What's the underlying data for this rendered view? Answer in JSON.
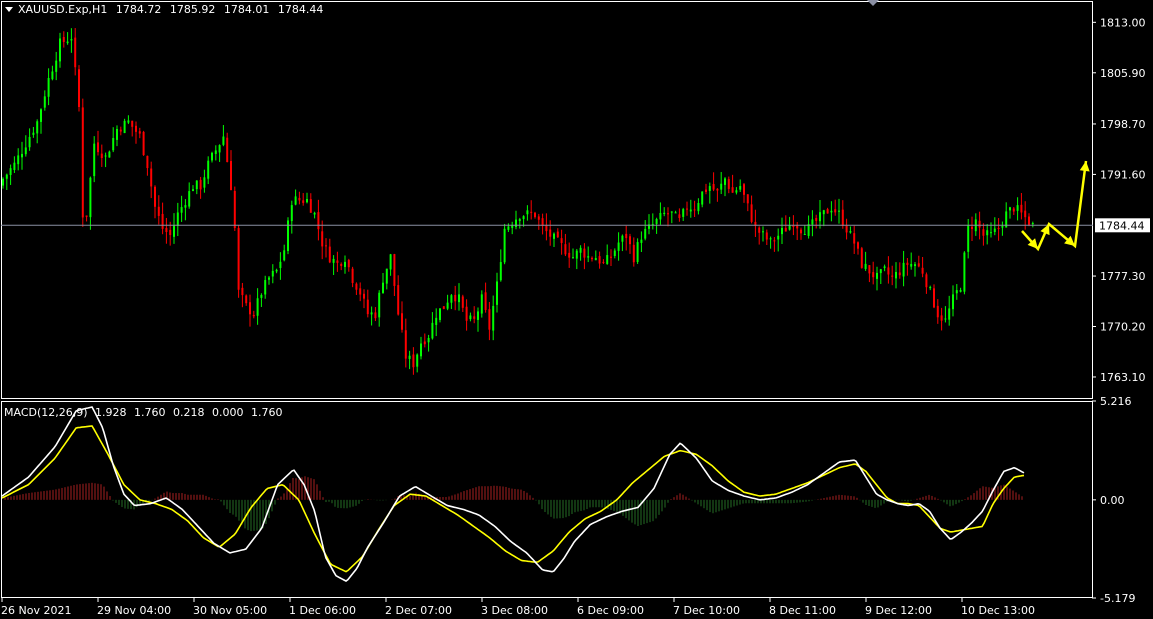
{
  "header": {
    "symbol": "XAUUSD.Exp,H1",
    "open": "1784.72",
    "high": "1785.92",
    "low": "1784.01",
    "close": "1784.44"
  },
  "macd_header": {
    "name": "MACD(12,26,9)",
    "values": [
      "1.928",
      "1.760",
      "0.218",
      "0.000",
      "1.760"
    ]
  },
  "colors": {
    "background": "#000000",
    "bull": "#00ff00",
    "bear": "#ff0000",
    "grid_border": "#ffffff",
    "current_price_line": "#8a8fa3",
    "arrow": "#ffff00",
    "macd_line": "#ffffff",
    "signal_line": "#ffff00",
    "hist_pos": "#8b1a1a",
    "hist_neg": "#1f5a1f"
  },
  "chart_data": [
    {
      "type": "candlestick",
      "ylim": [
        1760.0,
        1816.0
      ],
      "y_ticks": [
        "1813.00",
        "1805.90",
        "1798.70",
        "1791.60",
        "1784.44",
        "1777.30",
        "1770.20",
        "1763.10"
      ],
      "current_price": "1784.44",
      "x_ticks": [
        "26 Nov 2021",
        "29 Nov 04:00",
        "30 Nov 05:00",
        "1 Dec 06:00",
        "2 Dec 07:00",
        "3 Dec 08:00",
        "6 Dec 09:00",
        "7 Dec 10:00",
        "8 Dec 11:00",
        "9 Dec 12:00",
        "10 Dec 13:00"
      ],
      "close_path": [
        [
          0,
          1791
        ],
        [
          3,
          1793
        ],
        [
          6,
          1796
        ],
        [
          9,
          1799
        ],
        [
          12,
          1805
        ],
        [
          15,
          1810
        ],
        [
          18,
          1811
        ],
        [
          20,
          1801
        ],
        [
          21,
          1786
        ],
        [
          22,
          1786
        ],
        [
          24,
          1796
        ],
        [
          27,
          1794
        ],
        [
          30,
          1798
        ],
        [
          33,
          1799
        ],
        [
          36,
          1797
        ],
        [
          38,
          1793
        ],
        [
          40,
          1787
        ],
        [
          42,
          1784
        ],
        [
          44,
          1783
        ],
        [
          46,
          1786
        ],
        [
          48,
          1788
        ],
        [
          50,
          1790
        ],
        [
          52,
          1790
        ],
        [
          54,
          1793
        ],
        [
          56,
          1795
        ],
        [
          58,
          1797
        ],
        [
          60,
          1790
        ],
        [
          61,
          1784
        ],
        [
          62,
          1775
        ],
        [
          64,
          1773
        ],
        [
          66,
          1772
        ],
        [
          68,
          1775
        ],
        [
          70,
          1777
        ],
        [
          72,
          1778
        ],
        [
          74,
          1781
        ],
        [
          76,
          1788
        ],
        [
          78,
          1788
        ],
        [
          80,
          1788
        ],
        [
          82,
          1786
        ],
        [
          84,
          1782
        ],
        [
          86,
          1780
        ],
        [
          88,
          1779
        ],
        [
          90,
          1780
        ],
        [
          92,
          1777
        ],
        [
          94,
          1775
        ],
        [
          96,
          1772
        ],
        [
          98,
          1772
        ],
        [
          100,
          1777
        ],
        [
          102,
          1780
        ],
        [
          104,
          1772
        ],
        [
          106,
          1766
        ],
        [
          108,
          1765
        ],
        [
          110,
          1768
        ],
        [
          112,
          1769
        ],
        [
          114,
          1772
        ],
        [
          116,
          1773
        ],
        [
          118,
          1775
        ],
        [
          120,
          1774
        ],
        [
          122,
          1771
        ],
        [
          124,
          1771
        ],
        [
          126,
          1774
        ],
        [
          128,
          1770
        ],
        [
          130,
          1776
        ],
        [
          132,
          1784
        ],
        [
          134,
          1785
        ],
        [
          136,
          1786
        ],
        [
          138,
          1786
        ],
        [
          140,
          1786
        ],
        [
          142,
          1784
        ],
        [
          144,
          1783
        ],
        [
          146,
          1782
        ],
        [
          148,
          1781
        ],
        [
          150,
          1780
        ],
        [
          152,
          1781
        ],
        [
          154,
          1780
        ],
        [
          156,
          1780
        ],
        [
          158,
          1779
        ],
        [
          160,
          1780
        ],
        [
          162,
          1782
        ],
        [
          164,
          1783
        ],
        [
          166,
          1780
        ],
        [
          168,
          1783
        ],
        [
          170,
          1784
        ],
        [
          172,
          1785
        ],
        [
          174,
          1786
        ],
        [
          176,
          1786
        ],
        [
          178,
          1785
        ],
        [
          180,
          1787
        ],
        [
          182,
          1787
        ],
        [
          184,
          1789
        ],
        [
          186,
          1790
        ],
        [
          188,
          1789
        ],
        [
          190,
          1791
        ],
        [
          192,
          1789
        ],
        [
          194,
          1790
        ],
        [
          196,
          1787
        ],
        [
          198,
          1784
        ],
        [
          200,
          1783
        ],
        [
          202,
          1782
        ],
        [
          204,
          1783
        ],
        [
          206,
          1784
        ],
        [
          208,
          1785
        ],
        [
          210,
          1784
        ],
        [
          212,
          1784
        ],
        [
          214,
          1785
        ],
        [
          216,
          1786
        ],
        [
          218,
          1787
        ],
        [
          220,
          1786
        ],
        [
          222,
          1784
        ],
        [
          224,
          1782
        ],
        [
          226,
          1779
        ],
        [
          228,
          1778
        ],
        [
          230,
          1777
        ],
        [
          232,
          1778
        ],
        [
          234,
          1777
        ],
        [
          236,
          1778
        ],
        [
          238,
          1779
        ],
        [
          240,
          1779
        ],
        [
          242,
          1778
        ],
        [
          244,
          1775
        ],
        [
          246,
          1772
        ],
        [
          248,
          1771
        ],
        [
          250,
          1774
        ],
        [
          252,
          1776
        ],
        [
          254,
          1784
        ],
        [
          256,
          1785
        ],
        [
          258,
          1783
        ],
        [
          260,
          1783
        ],
        [
          262,
          1784
        ],
        [
          264,
          1786
        ],
        [
          266,
          1787
        ],
        [
          268,
          1786
        ],
        [
          270,
          1785
        ],
        [
          271,
          1784.44
        ]
      ],
      "projection_arrows": [
        [
          [
            1022,
            231
          ],
          [
            1038,
            249
          ],
          [
            1049,
            224
          ],
          [
            1075,
            246
          ],
          [
            1086,
            161
          ]
        ]
      ]
    },
    {
      "type": "line",
      "title": "MACD(12,26,9)",
      "ylim": [
        -5.179,
        5.216
      ],
      "y_ticks": [
        "5.216",
        "0.00",
        "-5.179"
      ],
      "series": [
        {
          "name": "MACD",
          "values": [
            [
              0,
              0.2
            ],
            [
              5,
              1.2
            ],
            [
              10,
              2.8
            ],
            [
              14,
              4.7
            ],
            [
              17,
              4.9
            ],
            [
              19,
              3.8
            ],
            [
              21,
              1.8
            ],
            [
              23,
              0.3
            ],
            [
              25,
              -0.3
            ],
            [
              28,
              -0.2
            ],
            [
              31,
              0.1
            ],
            [
              34,
              -0.5
            ],
            [
              37,
              -1.4
            ],
            [
              40,
              -2.3
            ],
            [
              43,
              -2.8
            ],
            [
              46,
              -2.6
            ],
            [
              49,
              -1.5
            ],
            [
              52,
              0.8
            ],
            [
              55,
              1.6
            ],
            [
              57,
              0.8
            ],
            [
              59,
              -0.6
            ],
            [
              61,
              -3.0
            ],
            [
              63,
              -4.0
            ],
            [
              65,
              -4.3
            ],
            [
              67,
              -3.6
            ],
            [
              69,
              -2.5
            ],
            [
              72,
              -1.2
            ],
            [
              75,
              0.2
            ],
            [
              78,
              0.7
            ],
            [
              81,
              0.2
            ],
            [
              84,
              -0.3
            ],
            [
              87,
              -0.5
            ],
            [
              90,
              -0.8
            ],
            [
              93,
              -1.4
            ],
            [
              96,
              -2.2
            ],
            [
              99,
              -2.8
            ],
            [
              102,
              -3.7
            ],
            [
              104,
              -3.8
            ],
            [
              106,
              -3.1
            ],
            [
              108,
              -2.2
            ],
            [
              111,
              -1.3
            ],
            [
              114,
              -0.9
            ],
            [
              117,
              -0.6
            ],
            [
              120,
              -0.4
            ],
            [
              123,
              0.6
            ],
            [
              126,
              2.4
            ],
            [
              128,
              3.0
            ],
            [
              131,
              2.2
            ],
            [
              134,
              1.0
            ],
            [
              137,
              0.5
            ],
            [
              140,
              0.2
            ],
            [
              143,
              0.0
            ],
            [
              146,
              0.1
            ],
            [
              149,
              0.4
            ],
            [
              152,
              0.8
            ],
            [
              155,
              1.4
            ],
            [
              158,
              2.0
            ],
            [
              161,
              2.1
            ],
            [
              163,
              1.2
            ],
            [
              165,
              0.3
            ],
            [
              167,
              0.0
            ],
            [
              169,
              -0.2
            ],
            [
              171,
              -0.3
            ],
            [
              173,
              -0.2
            ],
            [
              175,
              -0.6
            ],
            [
              177,
              -1.5
            ],
            [
              179,
              -2.1
            ],
            [
              181,
              -1.7
            ],
            [
              183,
              -1.2
            ],
            [
              185,
              -0.6
            ],
            [
              187,
              0.5
            ],
            [
              189,
              1.5
            ],
            [
              191,
              1.7
            ],
            [
              193,
              1.4
            ]
          ]
        },
        {
          "name": "Signal",
          "values": [
            [
              0,
              0.1
            ],
            [
              5,
              0.8
            ],
            [
              10,
              2.2
            ],
            [
              14,
              3.8
            ],
            [
              17,
              3.9
            ],
            [
              20,
              2.4
            ],
            [
              23,
              0.8
            ],
            [
              26,
              0.0
            ],
            [
              29,
              -0.2
            ],
            [
              32,
              -0.5
            ],
            [
              35,
              -1.1
            ],
            [
              38,
              -2.0
            ],
            [
              41,
              -2.5
            ],
            [
              44,
              -1.8
            ],
            [
              47,
              -0.4
            ],
            [
              50,
              0.6
            ],
            [
              53,
              0.8
            ],
            [
              56,
              0.0
            ],
            [
              59,
              -1.8
            ],
            [
              62,
              -3.4
            ],
            [
              65,
              -3.8
            ],
            [
              68,
              -3.0
            ],
            [
              71,
              -1.6
            ],
            [
              74,
              -0.3
            ],
            [
              77,
              0.3
            ],
            [
              80,
              0.2
            ],
            [
              83,
              -0.3
            ],
            [
              86,
              -0.8
            ],
            [
              89,
              -1.4
            ],
            [
              92,
              -2.0
            ],
            [
              95,
              -2.7
            ],
            [
              98,
              -3.2
            ],
            [
              101,
              -3.3
            ],
            [
              104,
              -2.7
            ],
            [
              107,
              -1.7
            ],
            [
              110,
              -1.0
            ],
            [
              113,
              -0.6
            ],
            [
              116,
              0.0
            ],
            [
              119,
              0.9
            ],
            [
              122,
              1.6
            ],
            [
              125,
              2.3
            ],
            [
              128,
              2.6
            ],
            [
              131,
              2.4
            ],
            [
              134,
              1.8
            ],
            [
              137,
              1.0
            ],
            [
              140,
              0.4
            ],
            [
              143,
              0.2
            ],
            [
              146,
              0.3
            ],
            [
              149,
              0.6
            ],
            [
              152,
              0.9
            ],
            [
              155,
              1.3
            ],
            [
              158,
              1.7
            ],
            [
              161,
              1.9
            ],
            [
              163,
              1.5
            ],
            [
              165,
              0.8
            ],
            [
              167,
              0.1
            ],
            [
              169,
              -0.2
            ],
            [
              171,
              -0.2
            ],
            [
              173,
              -0.3
            ],
            [
              175,
              -0.9
            ],
            [
              177,
              -1.5
            ],
            [
              179,
              -1.7
            ],
            [
              181,
              -1.6
            ],
            [
              183,
              -1.5
            ],
            [
              185,
              -1.4
            ],
            [
              187,
              -0.2
            ],
            [
              189,
              0.6
            ],
            [
              191,
              1.2
            ],
            [
              193,
              1.3
            ]
          ]
        }
      ]
    }
  ]
}
